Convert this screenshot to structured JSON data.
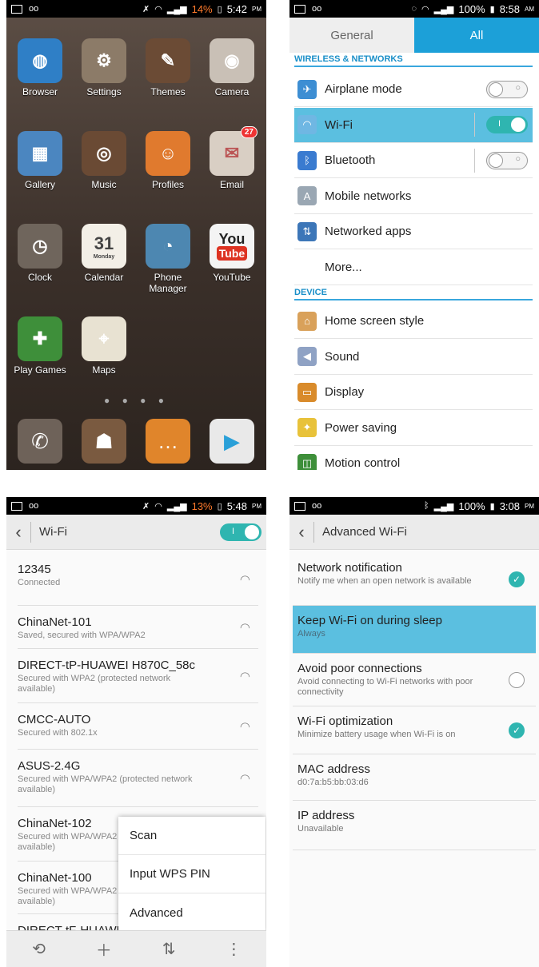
{
  "home": {
    "status": {
      "battery": "14%",
      "time": "5:42",
      "ampm": "PM"
    },
    "apps": [
      {
        "label": "Browser",
        "icon": "globe-icon",
        "color": "#2f7fc6"
      },
      {
        "label": "Settings",
        "icon": "gears-icon",
        "color": "#8c7b68"
      },
      {
        "label": "Themes",
        "icon": "pencils-icon",
        "color": "#6b4b35"
      },
      {
        "label": "Camera",
        "icon": "camera-icon",
        "color": "#c9c0b6"
      },
      {
        "label": "Gallery",
        "icon": "photo-icon",
        "color": "#4b86c0"
      },
      {
        "label": "Music",
        "icon": "vinyl-icon",
        "color": "#6a4a34"
      },
      {
        "label": "Profiles",
        "icon": "person-icon",
        "color": "#e07a2e"
      },
      {
        "label": "Email",
        "icon": "envelope-icon",
        "color": "#d9cfc4"
      },
      {
        "label": "Clock",
        "icon": "clock-icon",
        "color": "#6f655c"
      },
      {
        "label": "Calendar",
        "icon": "calendar-icon",
        "color": "#f3efe7"
      },
      {
        "label": "Phone\nManager",
        "icon": "gauge-icon",
        "color": "#4d87b1"
      },
      {
        "label": "YouTube",
        "icon": "youtube-icon",
        "color": "#f4f4f4"
      },
      {
        "label": "Play Games",
        "icon": "gamepad-icon",
        "color": "#3e8f3a"
      },
      {
        "label": "Maps",
        "icon": "map-icon",
        "color": "#e8e2d2"
      }
    ],
    "email_badge": "27",
    "calendar_day": "31",
    "calendar_weekday": "Monday",
    "youtube_text": "You",
    "youtube_tube": "Tube",
    "dock": [
      {
        "icon": "phone-icon",
        "color": "#6e6259"
      },
      {
        "icon": "contacts-icon",
        "color": "#7a5a40"
      },
      {
        "icon": "messaging-icon",
        "color": "#e0852b"
      },
      {
        "icon": "play-store-icon",
        "color": "#e9e9e9"
      }
    ]
  },
  "settings": {
    "status": {
      "battery": "100%",
      "time": "8:58",
      "ampm": "AM"
    },
    "tabs": {
      "general": "General",
      "all": "All"
    },
    "sections": {
      "wireless": "WIRELESS & NETWORKS",
      "device": "DEVICE"
    },
    "wireless_items": [
      {
        "label": "Airplane mode",
        "icon": "airplane-icon",
        "color": "#3d8ed3",
        "toggle": "off"
      },
      {
        "label": "Wi-Fi",
        "icon": "wifi-icon",
        "color": "#6fb7e3",
        "toggle": "on"
      },
      {
        "label": "Bluetooth",
        "icon": "bluetooth-icon",
        "color": "#3a7bd0",
        "toggle": "off"
      },
      {
        "label": "Mobile networks",
        "icon": "antenna-icon",
        "color": "#9aa7b3"
      },
      {
        "label": "Networked apps",
        "icon": "networked-apps-icon",
        "color": "#3c76b8"
      },
      {
        "label": "More..."
      }
    ],
    "device_items": [
      {
        "label": "Home screen style",
        "icon": "home-icon",
        "color": "#d9a15a"
      },
      {
        "label": "Sound",
        "icon": "speaker-icon",
        "color": "#8fa2c4"
      },
      {
        "label": "Display",
        "icon": "display-icon",
        "color": "#d98b2b"
      },
      {
        "label": "Power saving",
        "icon": "bulb-icon",
        "color": "#e8c23a"
      },
      {
        "label": "Motion control",
        "icon": "motion-icon",
        "color": "#3e8f3a"
      }
    ]
  },
  "wifi": {
    "status": {
      "battery": "13%",
      "time": "5:48",
      "ampm": "PM"
    },
    "title": "Wi-Fi",
    "networks": [
      {
        "name": "12345",
        "sub": "Connected"
      },
      {
        "name": "ChinaNet-101",
        "sub": "Saved, secured with WPA/WPA2"
      },
      {
        "name": "DIRECT-tP-HUAWEI H870C_58c",
        "sub": "Secured with WPA2 (protected network available)"
      },
      {
        "name": "CMCC-AUTO",
        "sub": "Secured with 802.1x"
      },
      {
        "name": "ASUS-2.4G",
        "sub": "Secured with WPA/WPA2 (protected network available)"
      },
      {
        "name": "ChinaNet-102",
        "sub": "Secured with WPA/WPA2 (protected network available)"
      },
      {
        "name": "ChinaNet-100",
        "sub": "Secured with WPA/WPA2 (protected network available)"
      },
      {
        "name": "DIRECT-tF-HUAWEI",
        "sub": ""
      }
    ],
    "menu": {
      "scan": "Scan",
      "wps_pin": "Input WPS PIN",
      "advanced": "Advanced"
    },
    "bottom_icons": [
      "wps-icon",
      "add-icon",
      "wifi-direct-icon",
      "overflow-icon"
    ]
  },
  "advanced": {
    "status": {
      "battery": "100%",
      "time": "3:08",
      "ampm": "PM"
    },
    "title": "Advanced Wi-Fi",
    "items": [
      {
        "title": "Network notification",
        "sub": "Notify me when an open network is available",
        "check": "on"
      },
      {
        "title": "Keep Wi-Fi on during sleep",
        "sub": "Always"
      },
      {
        "title": "Avoid poor connections",
        "sub": "Avoid connecting to Wi-Fi networks with poor connectivity",
        "check": "off"
      },
      {
        "title": "Wi-Fi optimization",
        "sub": "Minimize battery usage when Wi-Fi is on",
        "check": "on"
      },
      {
        "title": "MAC address",
        "sub": "d0:7a:b5:bb:03:d6"
      },
      {
        "title": "IP address",
        "sub": "Unavailable"
      }
    ]
  }
}
